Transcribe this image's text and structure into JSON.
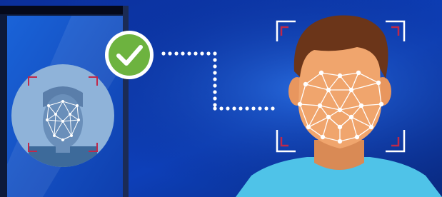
{
  "scene": {
    "phone_panel": "phone-face-scan",
    "main_panel": "face-recognition-mesh",
    "verified_icon": "checkmark-circle-icon",
    "connector": "dotted-connector-line"
  },
  "colors": {
    "background_navy": "#0a2a8a",
    "background_blue": "#1045c4",
    "phone_body": "#0d1a3a",
    "phone_screen": "#1557c9",
    "scan_circle": "#8fb3d9",
    "check_green": "#6db33f",
    "skin": "#f0a56d",
    "hair": "#6b3519",
    "shirt": "#4fc3e8",
    "mesh": "#ffffff",
    "bracket_red": "#c0284a",
    "bracket_white": "#ffffff"
  }
}
